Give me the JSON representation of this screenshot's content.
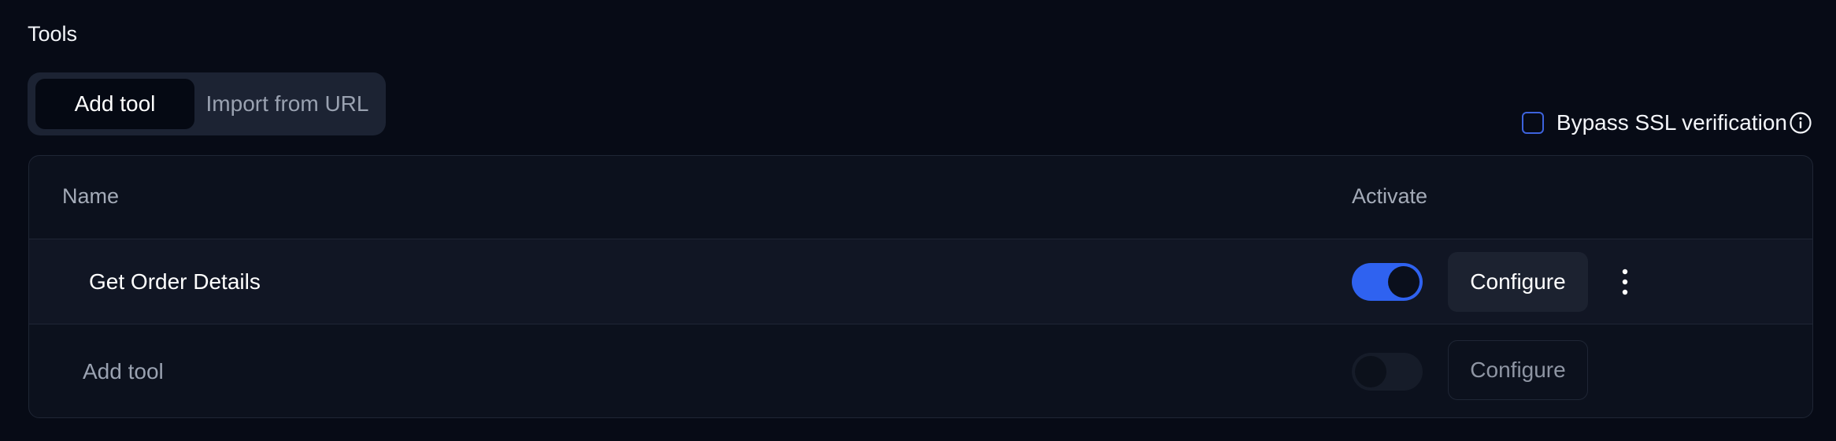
{
  "section": {
    "title": "Tools"
  },
  "tabs": [
    {
      "label": "Add tool",
      "active": true
    },
    {
      "label": "Import from URL",
      "active": false
    }
  ],
  "ssl": {
    "label": "Bypass SSL verification",
    "checked": false,
    "icon": "info-icon"
  },
  "table": {
    "headers": {
      "name": "Name",
      "activate": "Activate"
    },
    "rows": [
      {
        "name": "Get Order Details",
        "active": true,
        "configure_label": "Configure",
        "menu_icon": "more-vertical-icon"
      },
      {
        "name": "Add tool",
        "active": false,
        "configure_label": "Configure",
        "placeholder": true
      }
    ]
  },
  "colors": {
    "background": "#070b16",
    "accent": "#2f62f0",
    "checkbox_border": "#3d63dd"
  }
}
